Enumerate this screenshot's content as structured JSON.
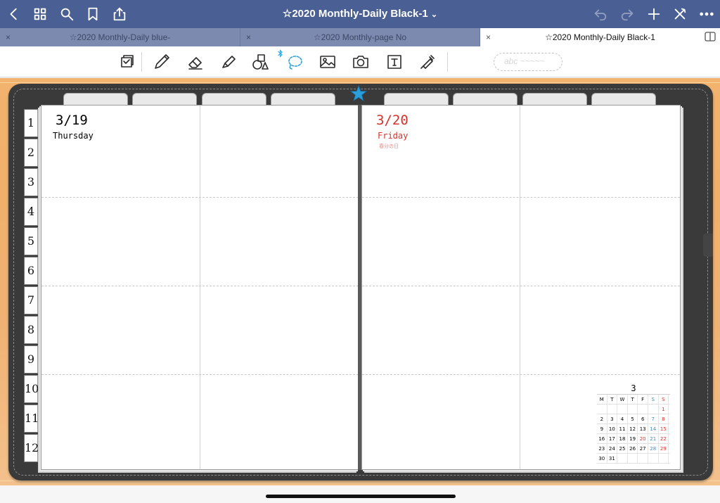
{
  "app": {
    "document_title": "☆2020 Monthly-Daily Black-1",
    "title_chevron": "⌄"
  },
  "tabs": [
    {
      "label": "☆2020 Monthly-Daily blue-",
      "close": "×",
      "active": false
    },
    {
      "label": "☆2020 Monthly-page  No",
      "close": "×",
      "active": false
    },
    {
      "label": "☆2020 Monthly-Daily Black-1",
      "close": "×",
      "active": true
    }
  ],
  "toolbar": {
    "pen_preview_text": "abc ~~~~~"
  },
  "colors": {
    "nav_bar": "#4a5f93",
    "tab_bar": "#7c8ab0",
    "active_tab": "#ffffff",
    "accent_blue": "#2a9fdc",
    "holiday_red": "#d8302a",
    "binder": "#3a3a3b"
  },
  "planner": {
    "left_page": {
      "date": "3/19",
      "weekday": "Thursday"
    },
    "right_page": {
      "date": "3/20",
      "weekday": "Friday",
      "holiday": "春分の日"
    },
    "month_tabs": [
      "1",
      "2",
      "3",
      "4",
      "5",
      "6",
      "7",
      "8",
      "9",
      "10",
      "11",
      "12"
    ],
    "mini_calendar": {
      "month": "3",
      "headers": [
        "M",
        "T",
        "W",
        "T",
        "F",
        "S",
        "S"
      ],
      "weeks": [
        [
          "",
          "",
          "",
          "",
          "",
          "",
          "1"
        ],
        [
          "2",
          "3",
          "4",
          "5",
          "6",
          "7",
          "8"
        ],
        [
          "9",
          "10",
          "11",
          "12",
          "13",
          "14",
          "15"
        ],
        [
          "16",
          "17",
          "18",
          "19",
          "20",
          "21",
          "22"
        ],
        [
          "23",
          "24",
          "25",
          "26",
          "27",
          "28",
          "29"
        ],
        [
          "30",
          "31",
          "",
          "",
          "",
          "",
          ""
        ]
      ],
      "holiday_dates": [
        "20"
      ]
    }
  }
}
